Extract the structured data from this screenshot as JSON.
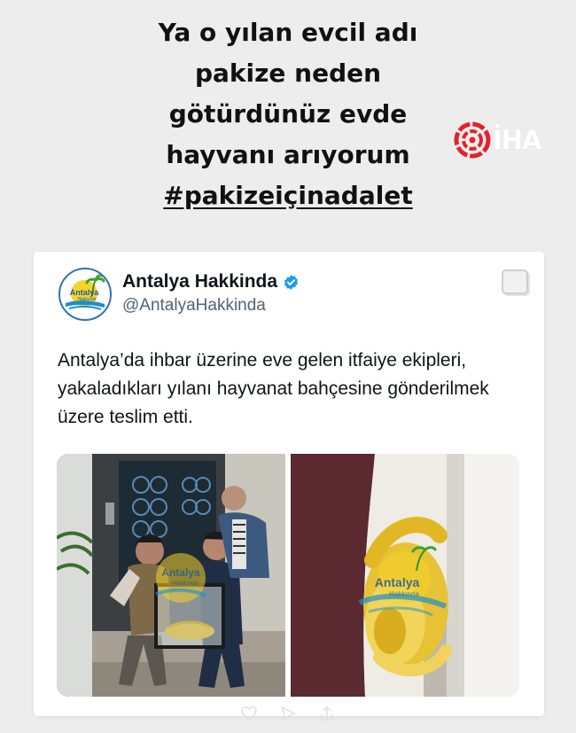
{
  "story": {
    "caption_lines": [
      "Ya o yılan evcil adı",
      "pakize neden",
      "götürdünüz evde",
      "hayvanı arıyorum"
    ],
    "hashtag": "#pakizeiçinadalet"
  },
  "watermark": {
    "text": "İHA",
    "color": "#e3222b"
  },
  "tweet": {
    "display_name": "Antalya Hakkinda",
    "handle": "@AntalyaHakkinda",
    "verified": true,
    "verified_color": "#1d9bf0",
    "avatar_logo_text": "Antalya",
    "avatar_logo_subtext": "Hakkında",
    "text": "Antalya’da ihbar üzerine eve gelen itfaiye ekipleri, yakaladıkları yılanı hayvanat bahçesine gönderilmek üzere teslim etti.",
    "photos": [
      {
        "description_icon": "people-with-snake-tank-photo",
        "overlay_text": "Antalya",
        "overlay_subtext": "Hakkında"
      },
      {
        "description_icon": "yellow-python-photo",
        "overlay_text": "Antalya",
        "overlay_subtext": "Hakkında"
      }
    ]
  },
  "icons": {
    "verified": "verified-badge-icon",
    "card_corner": "copy-icon",
    "story_controls": [
      "heart-icon",
      "send-icon",
      "share-icon"
    ]
  }
}
